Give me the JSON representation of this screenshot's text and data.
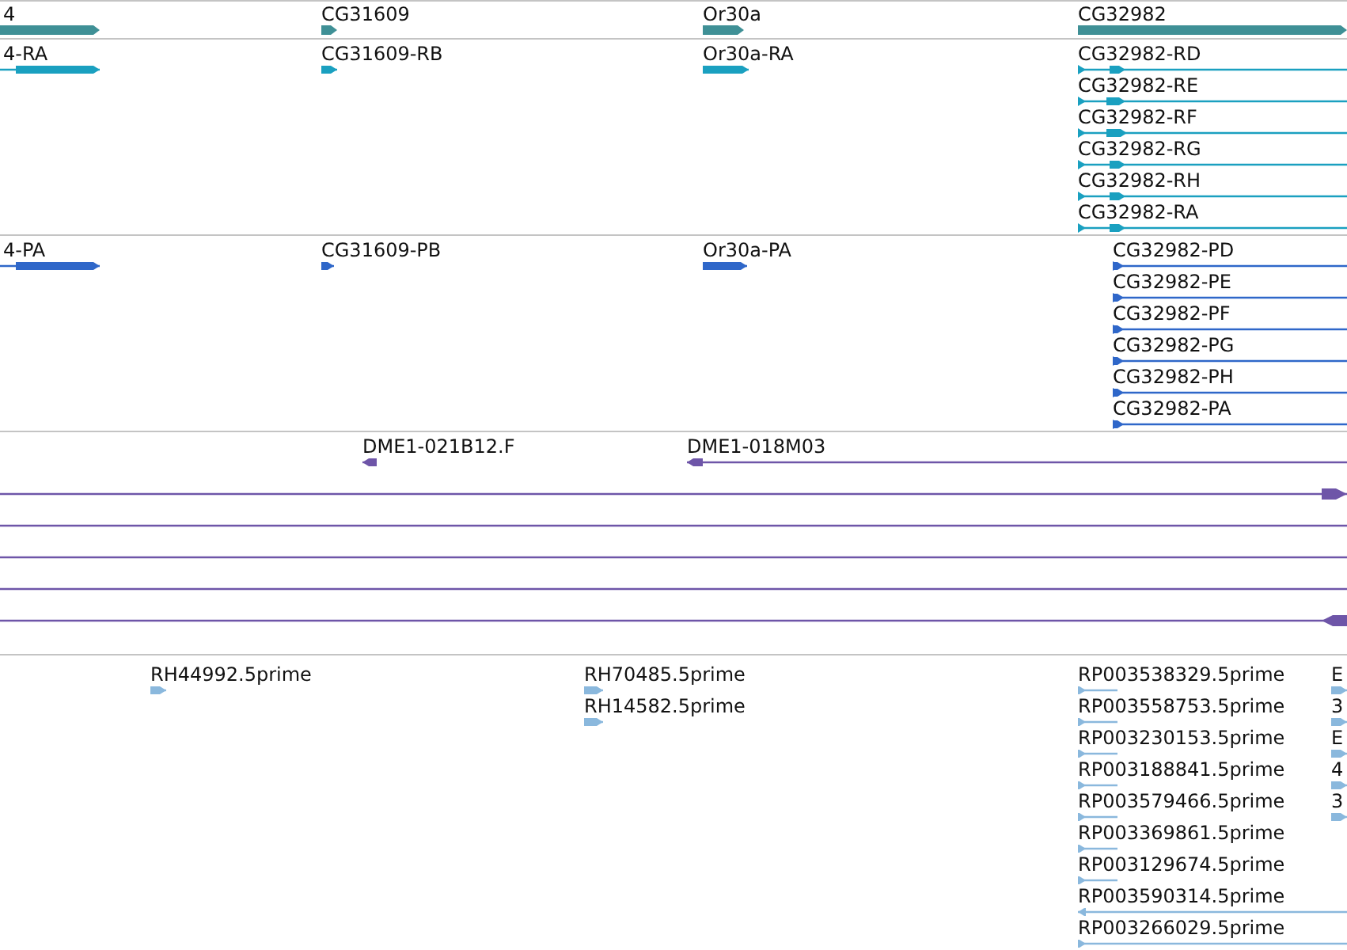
{
  "tracks": [
    {
      "kind": "gene",
      "features": [
        {
          "label": "4",
          "reverse": false
        },
        {
          "label": "CG31609",
          "reverse": false
        },
        {
          "label": "Or30a",
          "reverse": false
        },
        {
          "label": "CG32982",
          "reverse": false
        }
      ]
    },
    {
      "kind": "transcript",
      "features": [
        {
          "label": "4-RA",
          "reverse": false
        },
        {
          "label": "CG31609-RB",
          "reverse": false
        },
        {
          "label": "Or30a-RA",
          "reverse": false
        },
        {
          "label": "CG32982-RD",
          "reverse": false
        },
        {
          "label": "CG32982-RE",
          "reverse": false
        },
        {
          "label": "CG32982-RF",
          "reverse": false
        },
        {
          "label": "CG32982-RG",
          "reverse": false
        },
        {
          "label": "CG32982-RH",
          "reverse": false
        },
        {
          "label": "CG32982-RA",
          "reverse": false
        }
      ]
    },
    {
      "kind": "protein",
      "features": [
        {
          "label": "4-PA",
          "reverse": false
        },
        {
          "label": "CG31609-PB",
          "reverse": false
        },
        {
          "label": "Or30a-PA",
          "reverse": false
        },
        {
          "label": "CG32982-PD",
          "reverse": false
        },
        {
          "label": "CG32982-PE",
          "reverse": false
        },
        {
          "label": "CG32982-PF",
          "reverse": false
        },
        {
          "label": "CG32982-PG",
          "reverse": false
        },
        {
          "label": "CG32982-PH",
          "reverse": false
        },
        {
          "label": "CG32982-PA",
          "reverse": false
        }
      ]
    },
    {
      "kind": "clone",
      "features": [
        {
          "label": "DME1-021B12.F",
          "reverse": true
        },
        {
          "label": "DME1-018M03",
          "reverse": true
        },
        {
          "kind": "end-arrow",
          "reverse": false
        },
        {
          "kind": "line"
        },
        {
          "kind": "line"
        },
        {
          "kind": "line"
        },
        {
          "kind": "end-arrow",
          "reverse": true
        }
      ]
    },
    {
      "kind": "est",
      "features": [
        {
          "label": "RH44992.5prime",
          "reverse": false
        },
        {
          "label": "RH70485.5prime",
          "reverse": false
        },
        {
          "label": "RH14582.5prime",
          "reverse": false
        },
        {
          "label": "RP003538329.5prime",
          "reverse": false
        },
        {
          "label": "RP003558753.5prime",
          "reverse": false
        },
        {
          "label": "RP003230153.5prime",
          "reverse": false
        },
        {
          "label": "RP003188841.5prime",
          "reverse": false
        },
        {
          "label": "RP003579466.5prime",
          "reverse": false
        },
        {
          "label": "RP003369861.5prime",
          "reverse": false
        },
        {
          "label": "RP003129674.5prime",
          "reverse": false
        },
        {
          "label": "RP003590314.5prime",
          "reverse": true
        },
        {
          "label": "RP003266029.5prime",
          "reverse": false
        },
        {
          "label": "E",
          "reverse": false
        },
        {
          "label": "3",
          "reverse": false
        },
        {
          "label": "E",
          "reverse": false
        },
        {
          "label": "4",
          "reverse": false
        },
        {
          "label": "3",
          "reverse": false
        }
      ]
    }
  ]
}
